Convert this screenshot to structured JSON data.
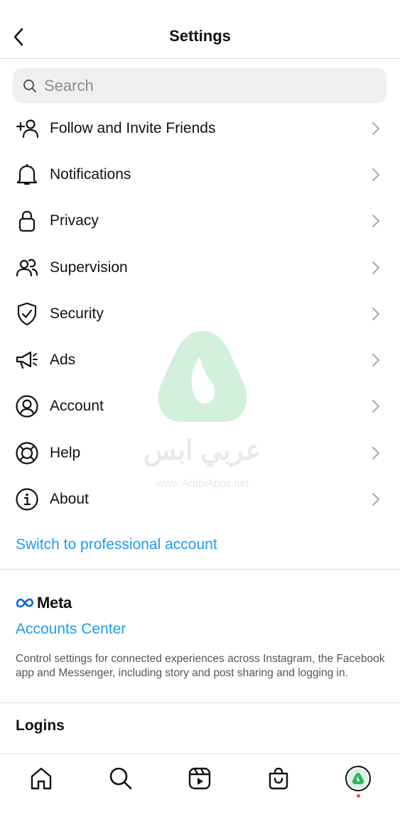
{
  "header": {
    "title": "Settings"
  },
  "search": {
    "placeholder": "Search"
  },
  "menu": [
    {
      "label": "Follow and Invite Friends",
      "icon": "add-person-icon"
    },
    {
      "label": "Notifications",
      "icon": "bell-icon"
    },
    {
      "label": "Privacy",
      "icon": "lock-icon"
    },
    {
      "label": "Supervision",
      "icon": "people-icon"
    },
    {
      "label": "Security",
      "icon": "shield-check-icon"
    },
    {
      "label": "Ads",
      "icon": "megaphone-icon"
    },
    {
      "label": "Account",
      "icon": "user-circle-icon"
    },
    {
      "label": "Help",
      "icon": "lifebuoy-icon"
    },
    {
      "label": "About",
      "icon": "info-icon"
    }
  ],
  "professional_link": "Switch to professional account",
  "meta": {
    "logo_text": "Meta",
    "accounts_center": "Accounts Center",
    "description": "Control settings for connected experiences across Instagram, the Facebook app and Messenger, including story and post sharing and logging in."
  },
  "logins": {
    "heading": "Logins"
  },
  "watermark": {
    "arabic": "عربي ابس",
    "url": "www.ArabiApps.net"
  },
  "tabbar": [
    "home-icon",
    "search-icon",
    "reels-icon",
    "shop-icon",
    "profile-avatar"
  ],
  "colors": {
    "link": "#1d9bf0",
    "divider": "#dbdbdb",
    "search_bg": "#efefef",
    "notification_dot": "#ed4956"
  }
}
